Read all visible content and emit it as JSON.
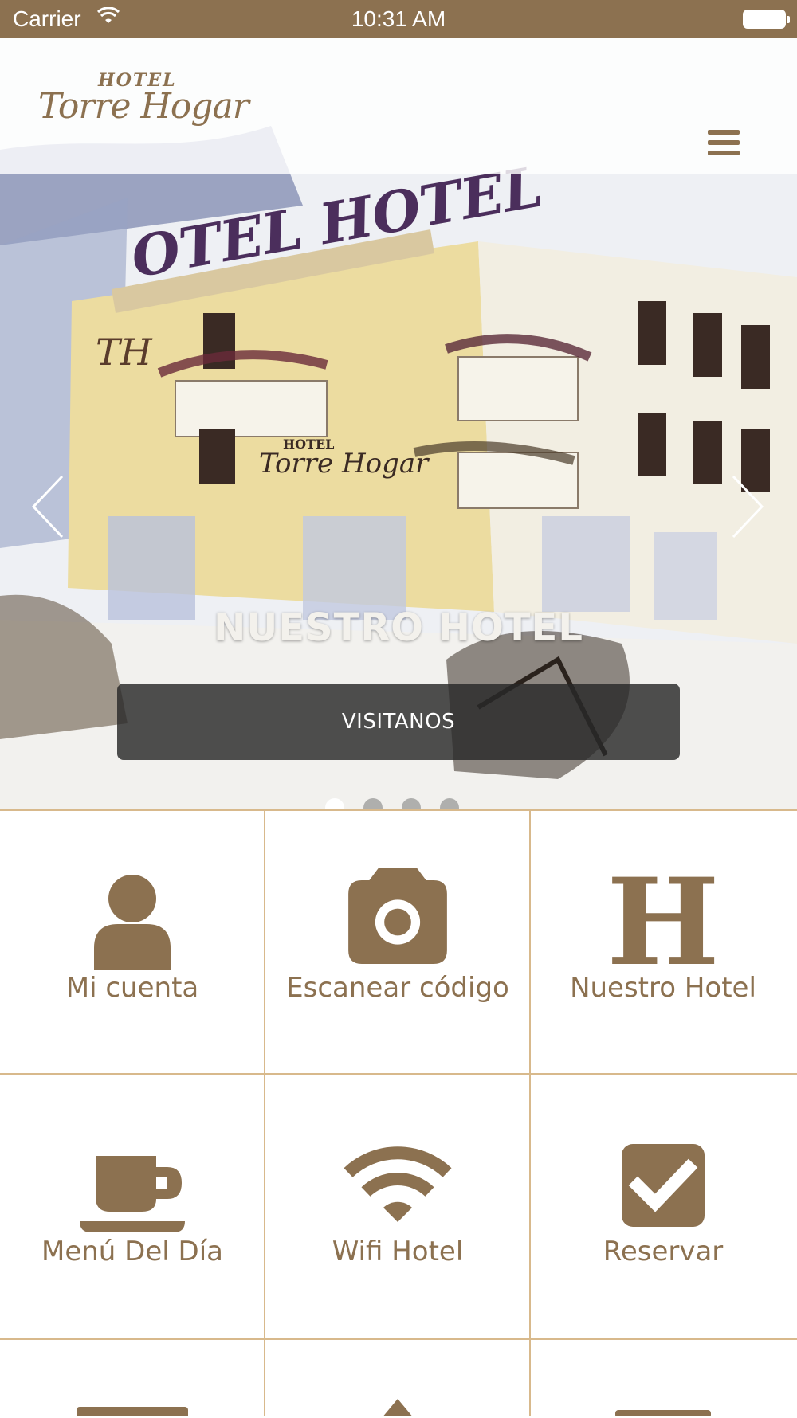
{
  "status_bar": {
    "carrier": "Carrier",
    "time": "10:31 AM"
  },
  "header": {
    "logo_hotel": "HOTEL",
    "logo_brand": "Torre Hogar"
  },
  "hero": {
    "slide_title": "NUESTRO HOTEL",
    "cta_label": "VISITANOS",
    "slide_count": 4,
    "active_slide": 1
  },
  "tiles": [
    {
      "label": "Mi cuenta",
      "icon": "user-icon"
    },
    {
      "label": "Escanear código",
      "icon": "camera-icon"
    },
    {
      "label": "Nuestro Hotel",
      "icon": "h-letter-icon"
    },
    {
      "label": "Menú Del Día",
      "icon": "coffee-cup-icon"
    },
    {
      "label": "Wifi Hotel",
      "icon": "wifi-icon"
    },
    {
      "label": "Reservar",
      "icon": "checkbox-icon"
    }
  ],
  "colors": {
    "brand": "#8c7150",
    "grid_line": "#d8b98c",
    "cta_bg": "#2e2e2e"
  }
}
